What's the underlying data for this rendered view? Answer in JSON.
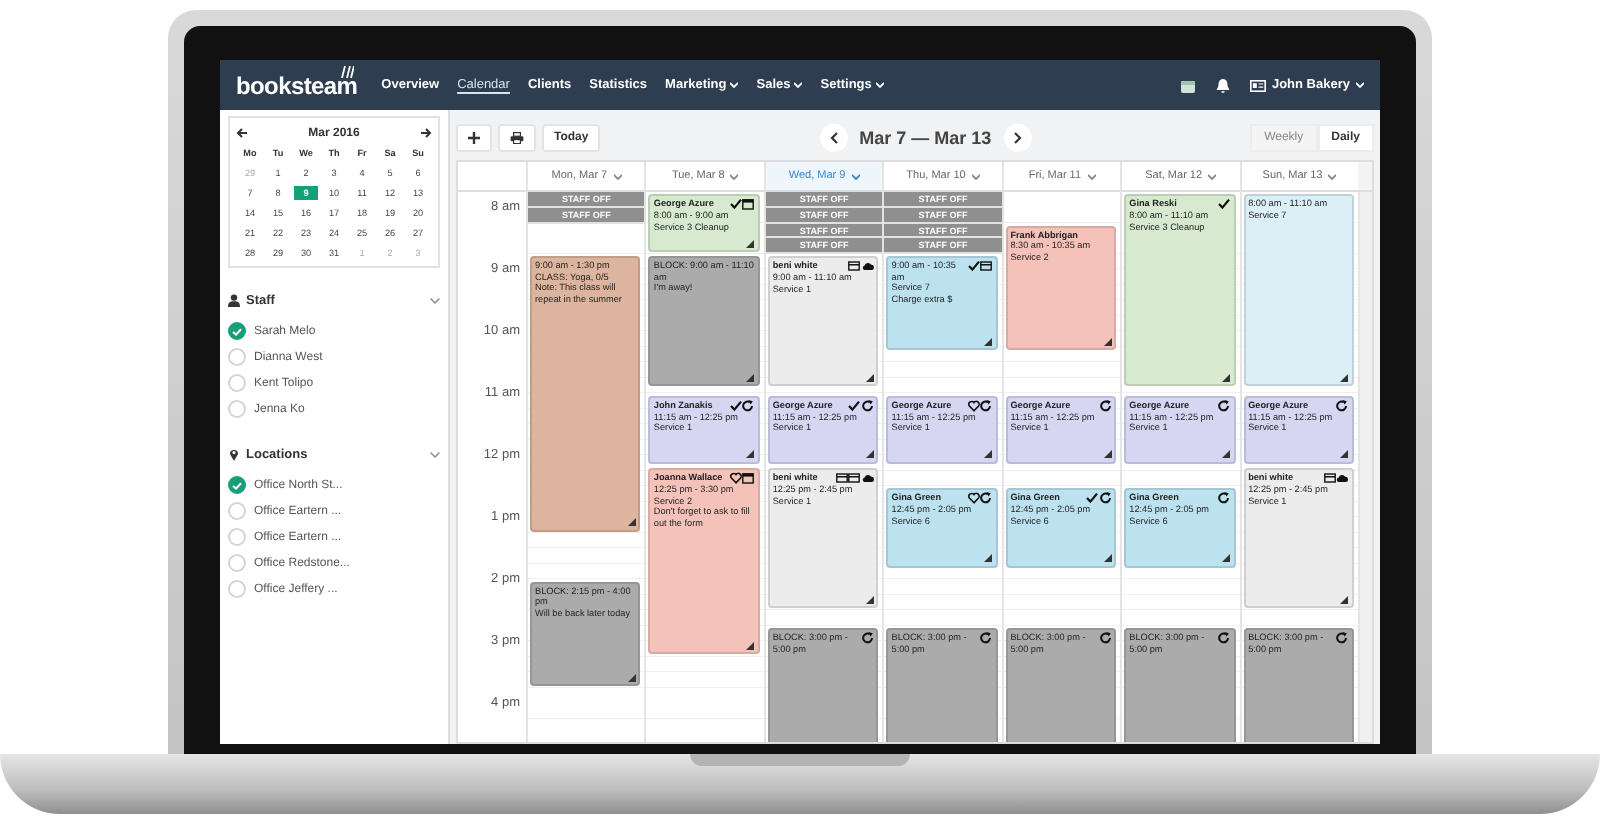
{
  "nav": {
    "logo": "booksteam",
    "items": [
      {
        "label": "Overview",
        "selected": false,
        "dropdown": false
      },
      {
        "label": "Calendar",
        "selected": true,
        "dropdown": false
      },
      {
        "label": "Clients",
        "selected": false,
        "dropdown": false
      },
      {
        "label": "Statistics",
        "selected": false,
        "dropdown": false
      },
      {
        "label": "Marketing",
        "selected": false,
        "dropdown": true
      },
      {
        "label": "Sales",
        "selected": false,
        "dropdown": true
      },
      {
        "label": "Settings",
        "selected": false,
        "dropdown": true
      }
    ],
    "user": "John Bakery"
  },
  "mini_calendar": {
    "title": "Mar 2016",
    "weekdays": [
      "Mo",
      "Tu",
      "We",
      "Th",
      "Fr",
      "Sa",
      "Su"
    ],
    "weeks": [
      [
        {
          "day": "29",
          "other_month": true,
          "selected": false
        },
        {
          "day": "1",
          "other_month": false,
          "selected": false
        },
        {
          "day": "2",
          "other_month": false,
          "selected": false
        },
        {
          "day": "3",
          "other_month": false,
          "selected": false
        },
        {
          "day": "4",
          "other_month": false,
          "selected": false
        },
        {
          "day": "5",
          "other_month": false,
          "selected": false
        },
        {
          "day": "6",
          "other_month": false,
          "selected": false
        }
      ],
      [
        {
          "day": "7",
          "other_month": false,
          "selected": false
        },
        {
          "day": "8",
          "other_month": false,
          "selected": false
        },
        {
          "day": "9",
          "other_month": false,
          "selected": true
        },
        {
          "day": "10",
          "other_month": false,
          "selected": false
        },
        {
          "day": "11",
          "other_month": false,
          "selected": false
        },
        {
          "day": "12",
          "other_month": false,
          "selected": false
        },
        {
          "day": "13",
          "other_month": false,
          "selected": false
        }
      ],
      [
        {
          "day": "14",
          "other_month": false,
          "selected": false
        },
        {
          "day": "15",
          "other_month": false,
          "selected": false
        },
        {
          "day": "16",
          "other_month": false,
          "selected": false
        },
        {
          "day": "17",
          "other_month": false,
          "selected": false
        },
        {
          "day": "18",
          "other_month": false,
          "selected": false
        },
        {
          "day": "19",
          "other_month": false,
          "selected": false
        },
        {
          "day": "20",
          "other_month": false,
          "selected": false
        }
      ],
      [
        {
          "day": "21",
          "other_month": false,
          "selected": false
        },
        {
          "day": "22",
          "other_month": false,
          "selected": false
        },
        {
          "day": "23",
          "other_month": false,
          "selected": false
        },
        {
          "day": "24",
          "other_month": false,
          "selected": false
        },
        {
          "day": "25",
          "other_month": false,
          "selected": false
        },
        {
          "day": "26",
          "other_month": false,
          "selected": false
        },
        {
          "day": "27",
          "other_month": false,
          "selected": false
        }
      ],
      [
        {
          "day": "28",
          "other_month": false,
          "selected": false
        },
        {
          "day": "29",
          "other_month": false,
          "selected": false
        },
        {
          "day": "30",
          "other_month": false,
          "selected": false
        },
        {
          "day": "31",
          "other_month": false,
          "selected": false
        },
        {
          "day": "1",
          "other_month": true,
          "selected": false
        },
        {
          "day": "2",
          "other_month": true,
          "selected": false
        },
        {
          "day": "3",
          "other_month": true,
          "selected": false
        }
      ]
    ]
  },
  "filters": [
    {
      "kind": "staff",
      "title": "Staff",
      "items": [
        {
          "label": "Sarah Melo",
          "checked": true
        },
        {
          "label": "Dianna West",
          "checked": false
        },
        {
          "label": "Kent Tolipo",
          "checked": false
        },
        {
          "label": "Jenna Ko",
          "checked": false
        }
      ]
    },
    {
      "kind": "location",
      "title": "Locations",
      "items": [
        {
          "label": "Office North St...",
          "checked": true
        },
        {
          "label": "Office Eartern ...",
          "checked": false
        },
        {
          "label": "Office Eartern ...",
          "checked": false
        },
        {
          "label": "Office Redstone...",
          "checked": false
        },
        {
          "label": "Office Jeffery ...",
          "checked": false
        }
      ]
    }
  ],
  "toolbar": {
    "today": "Today",
    "range": "Mar 7 — Mar 13",
    "views": [
      {
        "label": "Weekly",
        "selected": true
      },
      {
        "label": "Daily",
        "selected": false
      }
    ]
  },
  "calendar": {
    "hours": [
      "8 am",
      "9 am",
      "10 am",
      "11 am",
      "12 pm",
      "1 pm",
      "2 pm",
      "3 pm",
      "4 pm"
    ],
    "days": [
      {
        "label": "Mon, Mar 7",
        "today": false,
        "staff_off": [
          "STAFF OFF",
          "STAFF OFF"
        ],
        "events": [
          {
            "lines": [
              "9:00 am - 1:30 pm",
              "CLASS: Yoga, 0/5",
              "Note: This class will repeat in the summer"
            ],
            "color": "#ddb49d"
          },
          {
            "lines": [
              "BLOCK: 2:15 pm - 4:00 pm",
              "Will be back later today"
            ],
            "color": "#ababab"
          }
        ]
      },
      {
        "label": "Tue, Mar 8",
        "today": false,
        "events": [
          {
            "name": "George Azure",
            "lines": [
              "8:00 am - 9:00 am",
              "Service 3 Cleanup"
            ],
            "color": "#d7e9cf",
            "icons": [
              {
                "kind": "check"
              },
              {
                "kind": "calendar"
              }
            ]
          },
          {
            "lines": [
              "BLOCK: 9:00 am - 11:10 am",
              "I'm away!"
            ],
            "color": "#ababab"
          },
          {
            "name": "John Zanakis",
            "lines": [
              "11:15 am - 12:25 pm",
              "Service 1"
            ],
            "color": "#d6d6f2",
            "icons": [
              {
                "kind": "check"
              },
              {
                "kind": "cycle"
              }
            ]
          },
          {
            "name": "Joanna Wallace",
            "lines": [
              "12:25 pm - 3:30 pm",
              "Service 2",
              "Don't forget to ask to fill out the form"
            ],
            "color": "#f5c2ba",
            "icons": [
              {
                "kind": "heart"
              },
              {
                "kind": "calendar"
              }
            ]
          }
        ]
      },
      {
        "label": "Wed, Mar 9",
        "today": true,
        "staff_off": [
          "STAFF OFF",
          "STAFF OFF",
          "STAFF OFF",
          "STAFF OFF"
        ],
        "events": [
          {
            "name": "beni white",
            "lines": [
              "9:00 am - 11:10 am",
              "Service 1"
            ],
            "color": "#ececec",
            "icons": [
              {
                "kind": "card"
              },
              {
                "kind": "cloud"
              }
            ]
          },
          {
            "name": "George Azure",
            "lines": [
              "11:15 am - 12:25 pm",
              "Service 1"
            ],
            "color": "#d6d6f2",
            "icons": [
              {
                "kind": "check"
              },
              {
                "kind": "cycle"
              }
            ]
          },
          {
            "name": "beni white",
            "lines": [
              "12:25 pm - 2:45 pm",
              "Service 1"
            ],
            "color": "#ececec",
            "icons": [
              {
                "kind": "card"
              },
              {
                "kind": "card"
              },
              {
                "kind": "cloud"
              }
            ]
          },
          {
            "lines": [
              "BLOCK: 3:00 pm - 5:00 pm"
            ],
            "color": "#ababab",
            "icons": [
              {
                "kind": "cycle"
              }
            ]
          }
        ]
      },
      {
        "label": "Thu, Mar 10",
        "today": false,
        "staff_off": [
          "STAFF OFF",
          "STAFF OFF",
          "STAFF OFF",
          "STAFF OFF"
        ],
        "events": [
          {
            "lines": [
              "9:00 am - 10:35 am",
              "Service 7",
              "Charge extra $"
            ],
            "color": "#bce2f0",
            "icons": [
              {
                "kind": "check"
              },
              {
                "kind": "card"
              }
            ]
          },
          {
            "name": "George Azure",
            "lines": [
              "11:15 am - 12:25 pm",
              "Service 1"
            ],
            "color": "#d6d6f2",
            "icons": [
              {
                "kind": "heart"
              },
              {
                "kind": "cycle"
              }
            ]
          },
          {
            "name": "Gina Green",
            "lines": [
              "12:45 pm - 2:05 pm",
              "Service 6"
            ],
            "color": "#bce2f0",
            "icons": [
              {
                "kind": "heart"
              },
              {
                "kind": "cycle"
              }
            ]
          },
          {
            "lines": [
              "BLOCK: 3:00 pm - 5:00 pm"
            ],
            "color": "#ababab",
            "icons": [
              {
                "kind": "cycle"
              }
            ]
          }
        ]
      },
      {
        "label": "Fri, Mar 11",
        "today": false,
        "events": [
          {
            "name": "Frank Abbrigan",
            "lines": [
              "8:30 am - 10:35 am",
              "Service 2"
            ],
            "color": "#f5c2ba"
          },
          {
            "name": "George Azure",
            "lines": [
              "11:15 am - 12:25 pm",
              "Service 1"
            ],
            "color": "#d6d6f2",
            "icons": [
              {
                "kind": "cycle"
              }
            ]
          },
          {
            "name": "Gina Green",
            "lines": [
              "12:45 pm - 2:05 pm",
              "Service 6"
            ],
            "color": "#bce2f0",
            "icons": [
              {
                "kind": "check"
              },
              {
                "kind": "cycle"
              }
            ]
          },
          {
            "lines": [
              "BLOCK: 3:00 pm - 5:00 pm"
            ],
            "color": "#ababab",
            "icons": [
              {
                "kind": "cycle"
              }
            ]
          }
        ]
      },
      {
        "label": "Sat, Mar 12",
        "today": false,
        "events": [
          {
            "name": "Gina Reski",
            "lines": [
              "8:00 am - 11:10 am",
              "Service 3 Cleanup"
            ],
            "color": "#d7e9cf",
            "icons": [
              {
                "kind": "check"
              }
            ]
          },
          {
            "name": "George Azure",
            "lines": [
              "11:15 am - 12:25 pm",
              "Service 1"
            ],
            "color": "#d6d6f2",
            "icons": [
              {
                "kind": "cycle"
              }
            ]
          },
          {
            "name": "Gina Green",
            "lines": [
              "12:45 pm - 2:05 pm",
              "Service 6"
            ],
            "color": "#bce2f0",
            "icons": [
              {
                "kind": "cycle"
              }
            ]
          },
          {
            "lines": [
              "BLOCK: 3:00 pm - 5:00 pm"
            ],
            "color": "#ababab",
            "icons": [
              {
                "kind": "cycle"
              }
            ]
          }
        ]
      },
      {
        "label": "Sun, Mar 13",
        "today": false,
        "events": [
          {
            "lines": [
              "8:00 am - 11:10 am",
              "Service 7"
            ],
            "color": "#dbeff7"
          },
          {
            "name": "George Azure",
            "lines": [
              "11:15 am - 12:25 pm",
              "Service 1"
            ],
            "color": "#d6d6f2",
            "icons": [
              {
                "kind": "cycle"
              }
            ]
          },
          {
            "name": "beni white",
            "lines": [
              "12:25 pm - 2:45 pm",
              "Service 1"
            ],
            "color": "#ececec",
            "icons": [
              {
                "kind": "card"
              },
              {
                "kind": "cloud"
              }
            ]
          },
          {
            "lines": [
              "BLOCK: 3:00 pm - 5:00 pm"
            ],
            "color": "#ababab",
            "icons": [
              {
                "kind": "cycle"
              }
            ]
          }
        ]
      }
    ]
  }
}
